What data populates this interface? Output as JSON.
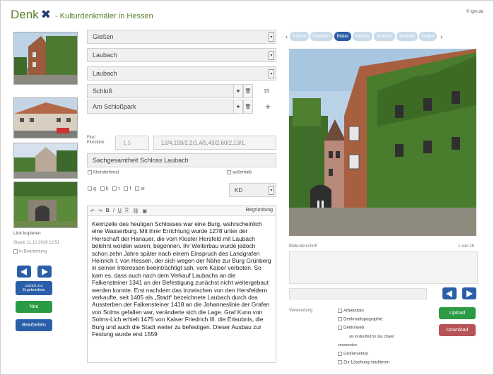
{
  "header": {
    "logo_denk": "Denk",
    "logo_x": "✖",
    "subtitle": "- Kulturdenkmäler in Hessen",
    "right_text": "© lgm.de"
  },
  "left": {
    "link_copy": "Link kopieren",
    "saved": "Stand: 11.10.2016 12:51",
    "in_progress": "In Bearbeitung",
    "back_label_line1": "zurück zur",
    "back_label_line2": "Ergebnisliste",
    "new_label": "Neu",
    "edit_label": "Bearbeiten"
  },
  "fields": {
    "kreis": "Gießen",
    "gemeinde": "Laubach",
    "ortsteil": "Laubach",
    "objekt": "Schloß",
    "strasse": "Am Schloßpark",
    "house_number": "15",
    "flur_label_line1": "Flur/",
    "flur_label_line2": "Flurstück",
    "flur": "1,5",
    "flurstueck": "12/4,159/2,2/1,4/5,43/2,60/2,13/1,",
    "gesamtheit": "Sachgesamtheit Schloss Laubach",
    "kleindenkmal": "Kleindenkmal",
    "ausserhalb": "außerhalb",
    "opt_g": "g",
    "opt_k": "k",
    "opt_t": "t",
    "opt_f": "f",
    "opt_w": "w",
    "ko": "KD"
  },
  "editor": {
    "toolbar_label": "Begründung",
    "text": "Keimzelle des heutigen Schlosses war eine Burg, wahrscheinlich eine Wasserburg. Mit ihrer Errichtung wurde 1278 unter der Herrschaft der Hanauer, die vom Kloster Hersfeld mit Laubach belehnt worden waren, begonnen. Ihr Weiterbau wurde jedoch schon zehn Jahre später nach einem Einspruch des Landgrafen Heinrich I. von Hessen, der sich wegen der Nähe zur Burg Grünberg in seinen Interessen beeinträchtigt sah, vom Kaiser verboten. So kam es, dass auch nach dem Verkauf Laubachs an die Falkensteiner 1341 an der Befestigung zunächst nicht weitergebaut werden konnte. Erst nachdem das inzwischen von den Hersfeldern verkaufte, seit 1405 als „Stadt“ bezeichnete Laubach durch das Aussterben der Falkensteiner 1418 an die Johanneslinie der Grafen von Solms gefallen war, veränderte sich die Lage. Graf Kuno von Solms-Lich erhielt 1475 von Kaiser Friedrich III. die Erlaubnis, die Burg und auch die Stadt weiter zu befestigen. Dieser Ausbau zur Festung wurde erst 1559"
  },
  "tabs": [
    "Karten",
    "Inventar",
    "Bilder",
    "Details",
    "Notizen",
    "Ordnen",
    "Daten"
  ],
  "active_tab": "Bilder",
  "image_panel": {
    "caption_label": "Bildunterschrift",
    "counter": "1 von 15",
    "verwendung_label": "Verwendung",
    "opt_arbeitsfoto": "Arbeitsfoto",
    "opt_denkmaltopographie": "Denkmaltopographie",
    "opt_denkxweb": "DenkXweb",
    "opt_tooltip": "als tooltip-Bild für das Objekt",
    "verwenden": "verwenden",
    "opt_grossinventar": "Großinventar",
    "opt_loeschung": "Zur Löschung markieren",
    "upload": "Upload",
    "download": "Download"
  },
  "colors": {
    "brand_green": "#5a7f2e",
    "brand_blue": "#1f3f6e",
    "button_blue": "#2a5ea8",
    "button_green": "#2b9a44",
    "button_red": "#b65357",
    "tab_inactive": "#c9dbe8"
  }
}
